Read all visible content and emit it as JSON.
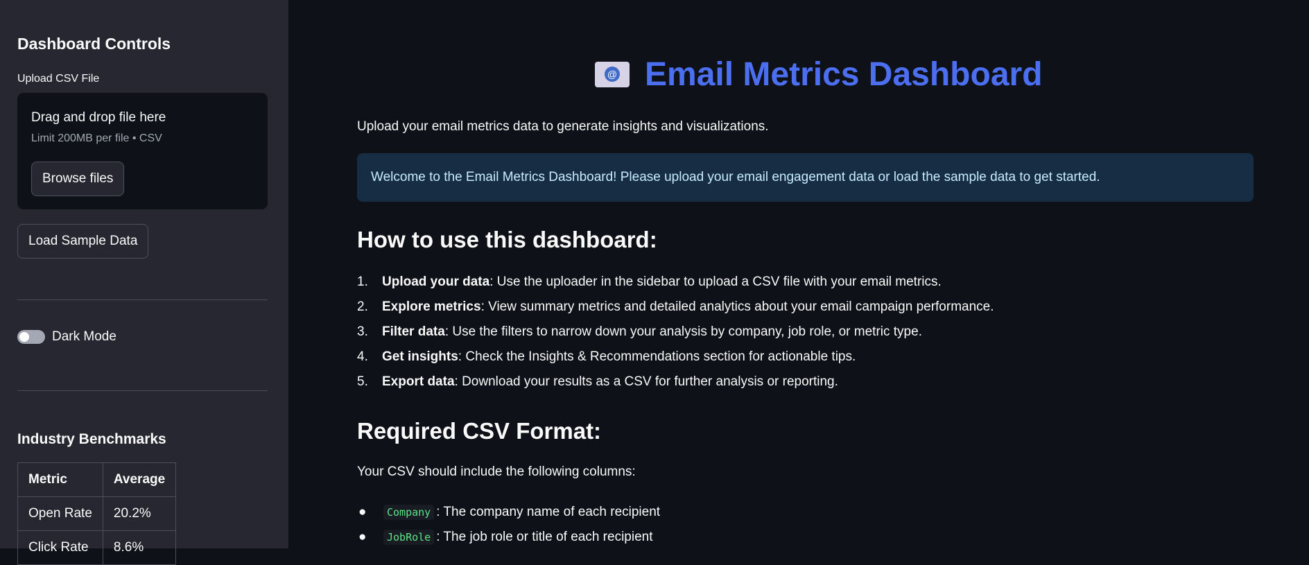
{
  "sidebar": {
    "title": "Dashboard Controls",
    "upload_label": "Upload CSV File",
    "dropzone_title": "Drag and drop file here",
    "dropzone_limit": "Limit 200MB per file • CSV",
    "browse_label": "Browse files",
    "sample_label": "Load Sample Data",
    "dark_mode_label": "Dark Mode",
    "dark_mode_on": false,
    "benchmarks_title": "Industry Benchmarks",
    "benchmarks_headers": [
      "Metric",
      "Average"
    ],
    "benchmarks_rows": [
      [
        "Open Rate",
        "20.2%"
      ],
      [
        "Click Rate",
        "8.6%"
      ]
    ]
  },
  "main": {
    "title": "Email Metrics Dashboard",
    "intro": "Upload your email metrics data to generate insights and visualizations.",
    "info": "Welcome to the Email Metrics Dashboard! Please upload your email engagement data or load the sample data to get started.",
    "howto_heading": "How to use this dashboard:",
    "steps": [
      {
        "num": "1.",
        "bold": "Upload your data",
        "text": ": Use the uploader in the sidebar to upload a CSV file with your email metrics."
      },
      {
        "num": "2.",
        "bold": "Explore metrics",
        "text": ": View summary metrics and detailed analytics about your email campaign performance."
      },
      {
        "num": "3.",
        "bold": "Filter data",
        "text": ": Use the filters to narrow down your analysis by company, job role, or metric type."
      },
      {
        "num": "4.",
        "bold": "Get insights",
        "text": ": Check the Insights & Recommendations section for actionable tips."
      },
      {
        "num": "5.",
        "bold": "Export data",
        "text": ": Download your results as a CSV for further analysis or reporting."
      }
    ],
    "csv_heading": "Required CSV Format:",
    "csv_intro": "Your CSV should include the following columns:",
    "columns": [
      {
        "code": "Company",
        "text": ": The company name of each recipient"
      },
      {
        "code": "JobRole",
        "text": ": The job role or title of each recipient"
      }
    ]
  },
  "colors": {
    "accent": "#4b6ff0",
    "info_bg": "#172d43",
    "code_text": "#5ce488"
  }
}
